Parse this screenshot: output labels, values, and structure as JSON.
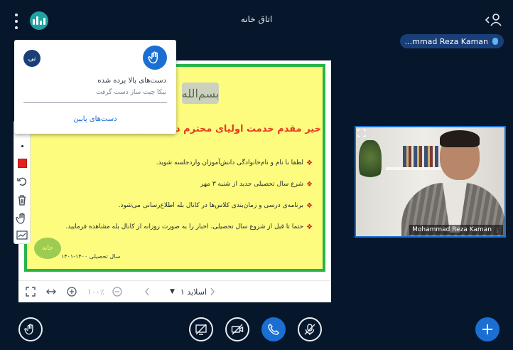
{
  "header": {
    "room_title": "اتاق خانه",
    "menu_icon": "kebab-menu-icon",
    "stats_icon": "connection-stats-icon",
    "user_icon": "user-list-toggle-icon"
  },
  "presenter_pill": {
    "name": "...mmad Reza Kaman"
  },
  "popup": {
    "avatar_initials": "نی",
    "title": "دست‌های بالا برده شده",
    "subtitle": "نیکا چیت ساز دست گرفت",
    "lower_hands": "دست‌های پایین"
  },
  "slide": {
    "basmala": "بسم‌الله",
    "heading": "خیر مقدم خدمت اولیای محترم دانش‌آموز",
    "bullets": [
      "لطفا با نام و نام‌خانوادگی دانش‌آموزان واردجلسه شوید.",
      "شرع سال تحصیلی جدید از شنبه ۳ مهر",
      "برنامه‌ی درسی و زمان‌بندی کلاس‌ها در کانال بله اطلاع‌رسانی می‌شود.",
      "حتما تا قبل از شروع سال تحصیلی، اخبار را به صورت روزانه از کانال بله مشاهده فرمایید."
    ],
    "logo": "خانه",
    "school_year": "سال تحصیلی ۱۴۰۰-۱۴۰۱"
  },
  "slide_toolbar": {
    "zoom": "۱۰۰٪",
    "slide_select": "اسلاید ۱"
  },
  "webcam": {
    "name": "Mohammad Reza Kaman"
  },
  "colors": {
    "background": "#06172b",
    "accent_blue": "#1b6fd2",
    "slide_yellow": "#fdfc7e",
    "slide_border": "#28b44a",
    "heading_red": "#e73a22",
    "pen_red": "#e32020"
  }
}
